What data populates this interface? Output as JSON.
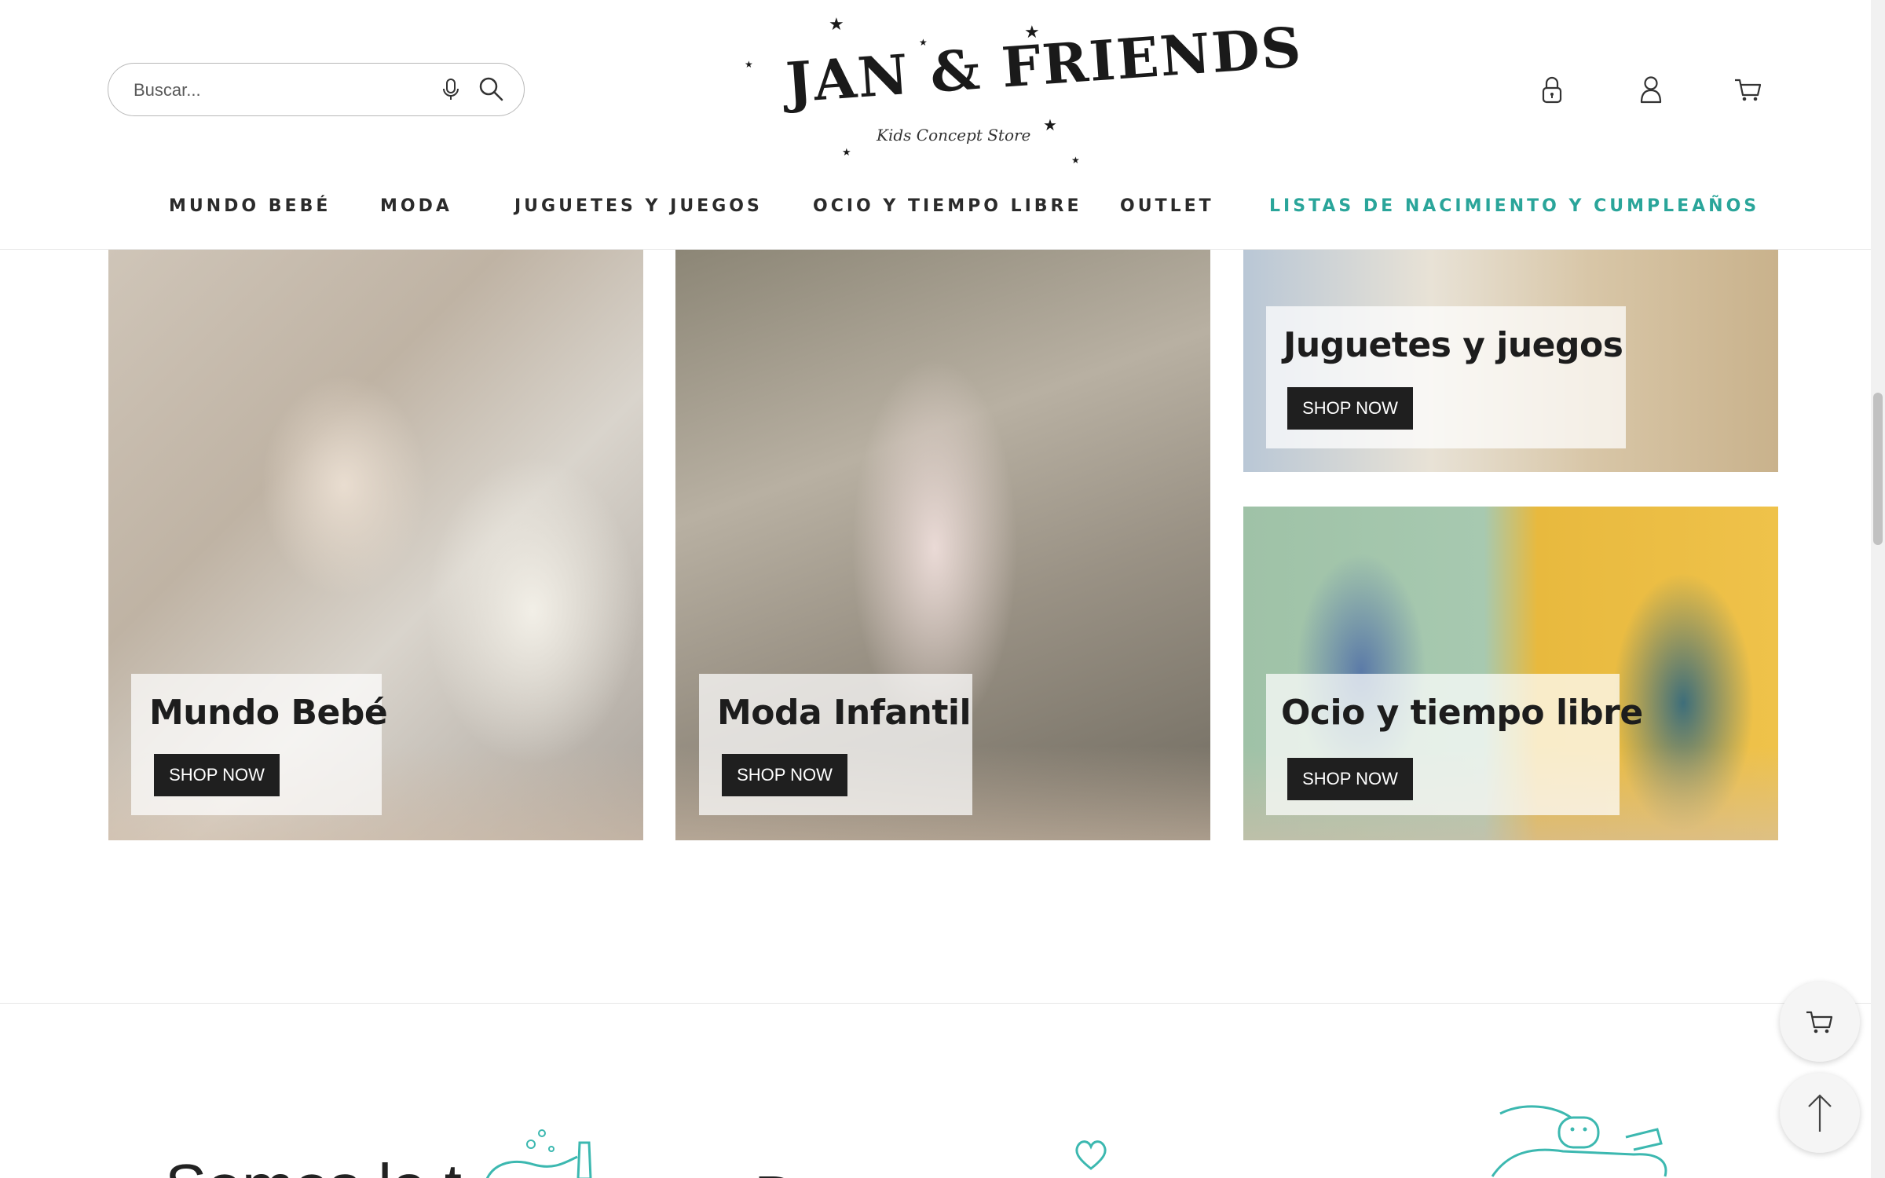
{
  "header": {
    "search": {
      "placeholder": "Buscar..."
    },
    "logo": {
      "name": "JAN & FRIENDS",
      "tagline": "Kids Concept Store"
    },
    "icons": [
      "lock-icon",
      "user-icon",
      "cart-icon"
    ]
  },
  "nav": {
    "items": [
      {
        "label": "MUNDO BEBÉ"
      },
      {
        "label": "MODA"
      },
      {
        "label": "JUGUETES Y JUEGOS"
      },
      {
        "label": "OCIO Y TIEMPO LIBRE"
      },
      {
        "label": "OUTLET"
      },
      {
        "label": "LISTAS DE NACIMIENTO Y CUMPLEAÑOS"
      }
    ],
    "accent_color": "#2aa59a"
  },
  "categories": [
    {
      "title": "Mundo Bebé",
      "button": "SHOP NOW"
    },
    {
      "title": "Moda Infantil",
      "button": "SHOP NOW"
    },
    {
      "title": "Juguetes y juegos",
      "button": "SHOP NOW"
    },
    {
      "title": "Ocio y tiempo libre",
      "button": "SHOP NOW"
    }
  ],
  "footer": {
    "text_1": "Somos la t",
    "text_2": "D"
  },
  "floating": {
    "icons": [
      "cart-icon",
      "arrow-up-icon"
    ]
  }
}
